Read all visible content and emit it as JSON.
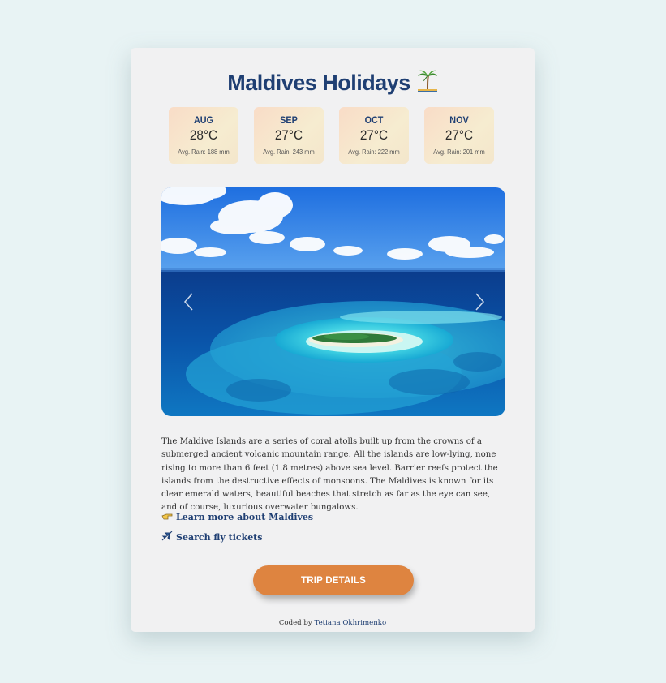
{
  "page": {
    "title": "Maldives Holidays",
    "title_icon": "palm-tree-island-icon"
  },
  "months": [
    {
      "name": "AUG",
      "temp": "28°C",
      "rain": "Avg. Rain: 188 mm"
    },
    {
      "name": "SEP",
      "temp": "27°C",
      "rain": "Avg. Rain: 243 mm"
    },
    {
      "name": "OCT",
      "temp": "27°C",
      "rain": "Avg. Rain: 222 mm"
    },
    {
      "name": "NOV",
      "temp": "27°C",
      "rain": "Avg. Rain: 201 mm"
    }
  ],
  "carousel": {
    "prev_icon": "chevron-left-icon",
    "next_icon": "chevron-right-icon"
  },
  "description": "The Maldive Islands are a series of coral atolls built up from the crowns of a submerged ancient volcanic mountain range. All the islands are low-lying, none rising to more than 6 feet (1.8 metres) above sea level. Barrier reefs protect the islands from the destructive effects of monsoons. The Maldives is known for its clear emerald waters, beautiful beaches that stretch as far as the eye can see, and of course, luxurious overwater bungalows.",
  "links": {
    "learn_more": {
      "icon": "pointing-hand-icon",
      "label": "Learn more about Maldives"
    },
    "fly_tickets": {
      "icon": "airplane-icon",
      "label": "Search fly tickets"
    }
  },
  "button": {
    "label": "TRIP DETAILS"
  },
  "footer": {
    "prefix": "Coded by ",
    "author": "Tetiana Okhrimenko"
  },
  "colors": {
    "background": "#e8f3f4",
    "card": "#f1f1f2",
    "title": "#1f3f73",
    "button": "#de8440",
    "month_card_start": "#f9dcc7",
    "month_card_end": "#f6ecd0"
  }
}
